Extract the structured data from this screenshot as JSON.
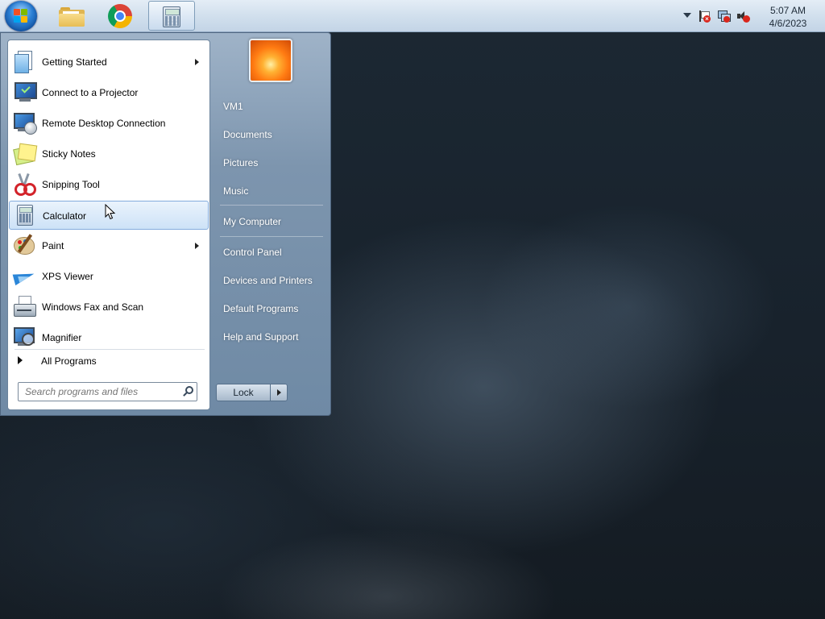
{
  "taskbar": {
    "start_button": "start-orb",
    "pinned": [
      {
        "name": "Windows Explorer",
        "icon": "folder-icon"
      },
      {
        "name": "Google Chrome",
        "icon": "chrome-icon"
      },
      {
        "name": "Calculator",
        "icon": "calculator-icon",
        "active": true
      }
    ],
    "clock": {
      "time": "5:07 AM",
      "date": "4/6/2023"
    }
  },
  "start_menu": {
    "programs": [
      {
        "label": "Getting Started",
        "icon": "getting-started-icon",
        "submenu": true
      },
      {
        "label": "Connect to a Projector",
        "icon": "projector-icon",
        "submenu": false
      },
      {
        "label": "Remote Desktop Connection",
        "icon": "remote-desktop-icon",
        "submenu": false
      },
      {
        "label": "Sticky Notes",
        "icon": "sticky-notes-icon",
        "submenu": false
      },
      {
        "label": "Snipping Tool",
        "icon": "scissors-icon",
        "submenu": false
      },
      {
        "label": "Calculator",
        "icon": "calculator-icon",
        "submenu": false,
        "highlighted": true
      },
      {
        "label": "Paint",
        "icon": "paint-palette-icon",
        "submenu": true
      },
      {
        "label": "XPS Viewer",
        "icon": "xps-viewer-icon",
        "submenu": false
      },
      {
        "label": "Windows Fax and Scan",
        "icon": "fax-icon",
        "submenu": false
      },
      {
        "label": "Magnifier",
        "icon": "magnifier-icon",
        "submenu": false
      }
    ],
    "all_programs": "All Programs",
    "search": {
      "placeholder": "Search programs and files",
      "value": ""
    },
    "right_links": [
      "VM1",
      "Documents",
      "Pictures",
      "Music",
      "My Computer",
      "Control Panel",
      "Devices and Printers",
      "Default Programs",
      "Help and Support"
    ],
    "lock_label": "Lock"
  }
}
